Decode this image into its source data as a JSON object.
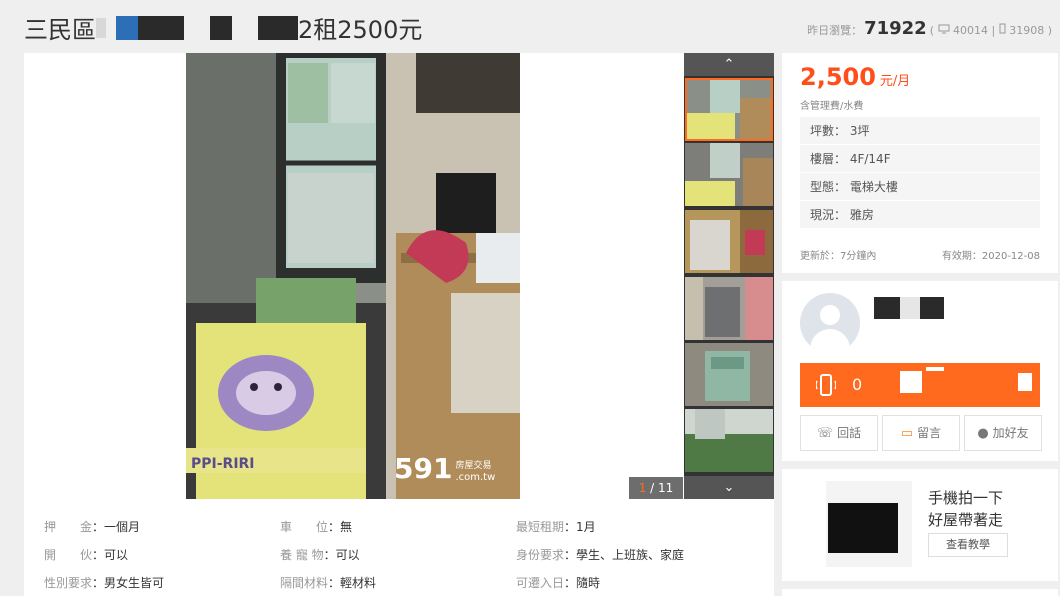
{
  "header": {
    "title_prefix": "三民區",
    "title_suffix": "2租2500元",
    "views_label": "昨日瀏覽：",
    "views_count": "71922",
    "views_pc": "40014",
    "views_mobile": "31908"
  },
  "gallery": {
    "watermark_big": "591",
    "watermark_small": "房屋交易",
    "watermark_url": ".com.tw",
    "counter_current": "1",
    "counter_total": "/ 11",
    "nav_up": "⌃",
    "nav_down": "⌄"
  },
  "info": [
    {
      "label": "押　　金",
      "value": "一個月"
    },
    {
      "label": "車　　位",
      "value": "無"
    },
    {
      "label": "最短租期",
      "value": "1月"
    },
    {
      "label": "開　　伙",
      "value": "可以"
    },
    {
      "label": "養 寵 物",
      "value": "可以"
    },
    {
      "label": "身份要求",
      "value": "學生、上班族、家庭"
    },
    {
      "label": "性別要求",
      "value": "男女生皆可"
    },
    {
      "label": "隔間材料",
      "value": "輕材料"
    },
    {
      "label": "可遷入日",
      "value": "隨時"
    }
  ],
  "price": {
    "amount": "2,500",
    "unit": "元/月",
    "note": "含管理費/水費",
    "attrs": [
      {
        "label": "坪數",
        "value": "3坪"
      },
      {
        "label": "樓層",
        "value": "4F/14F"
      },
      {
        "label": "型態",
        "value": "電梯大樓"
      },
      {
        "label": "現況",
        "value": "雅房"
      }
    ],
    "update": "更新於：7分鐘內",
    "expire": "有效期：2020-12-08"
  },
  "contact": {
    "phone_visible": "0",
    "buttons": {
      "call": "回話",
      "message": "留言",
      "friend": "加好友"
    }
  },
  "app": {
    "line1": "手機拍一下",
    "line2": "好屋帶著走",
    "button": "查看教學"
  },
  "colors": {
    "accent": "#ff6a1f",
    "price": "#ff4e1a",
    "background": "#efefef"
  }
}
